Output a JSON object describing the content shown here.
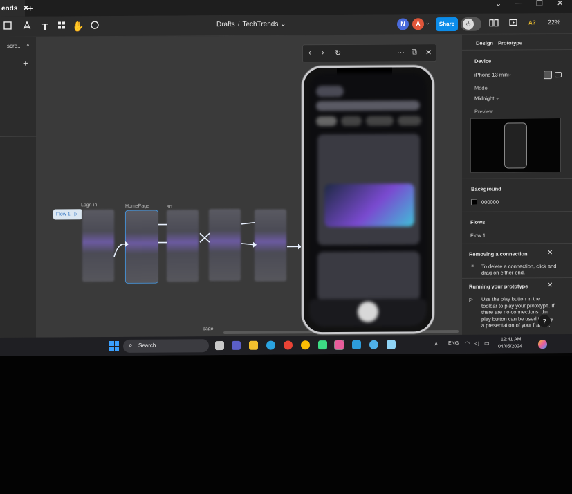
{
  "window": {
    "tab_label": "ends",
    "tab_close": "✕",
    "add_tab": "+",
    "controls": {
      "chevron": "⌄",
      "minimize": "—",
      "maximize": "❐",
      "close": "✕"
    }
  },
  "toolbar": {
    "breadcrumb_parent": "Drafts",
    "breadcrumb_separator": "/",
    "breadcrumb_current": "TechTrends",
    "breadcrumb_chevron": "⌄",
    "avatars": [
      {
        "initial": "N",
        "color": "#4a6bdc"
      },
      {
        "initial": "A",
        "color": "#e0563a"
      }
    ],
    "share_label": "Share",
    "zoom": "22%",
    "accessibility_label": "A?",
    "icons": [
      "frame-tool-icon",
      "pen-tool-icon",
      "text-tool-icon",
      "components-icon",
      "hand-tool-icon",
      "comment-icon",
      "library-icon",
      "present-icon"
    ]
  },
  "left_panel": {
    "page_tab": "scre...",
    "add": "+"
  },
  "canvas": {
    "flow_chip": "Flow 1",
    "frames": [
      {
        "label": "Logn-in"
      },
      {
        "label": "HomePage"
      },
      {
        "label": "art"
      },
      {
        "label": ""
      },
      {
        "label": ""
      }
    ],
    "page_label": "page"
  },
  "preview_window": {
    "back": "‹",
    "forward": "›",
    "restart": "↻",
    "more": "⋯",
    "open_external": "⧉",
    "close": "✕"
  },
  "right_panel": {
    "tabs": [
      "Design",
      "Prototype"
    ],
    "device_heading": "Device",
    "device_value": "iPhone 13 mini",
    "model_heading": "Model",
    "model_value": "Midnight",
    "preview_heading": "Preview",
    "background_heading": "Background",
    "background_value": "000000",
    "flows_heading": "Flows",
    "flow_item": "Flow 1",
    "tip1_title": "Removing a connection",
    "tip1_body": "To delete a connection, click and drag on either end.",
    "tip2_title": "Running your prototype",
    "tip2_body": "Use the play button in the toolbar to play your prototype. If there are no connections, the play button can be used to play a presentation of your frames.",
    "help": "?",
    "close": "✕",
    "chevron": "⌄"
  },
  "taskbar": {
    "search_label": "Search",
    "language": "ENG",
    "time": "12:41 AM",
    "date": "04/05/2024",
    "app_colors": [
      "#c8c8c8",
      "#5b5fc7",
      "#f2c12e",
      "#2aa3e0",
      "#ea4335",
      "#fbbc04",
      "#3ddc84",
      "#e85d9c",
      "#2d9cdb",
      "#4fb0e8",
      "#8fd3f5"
    ]
  }
}
